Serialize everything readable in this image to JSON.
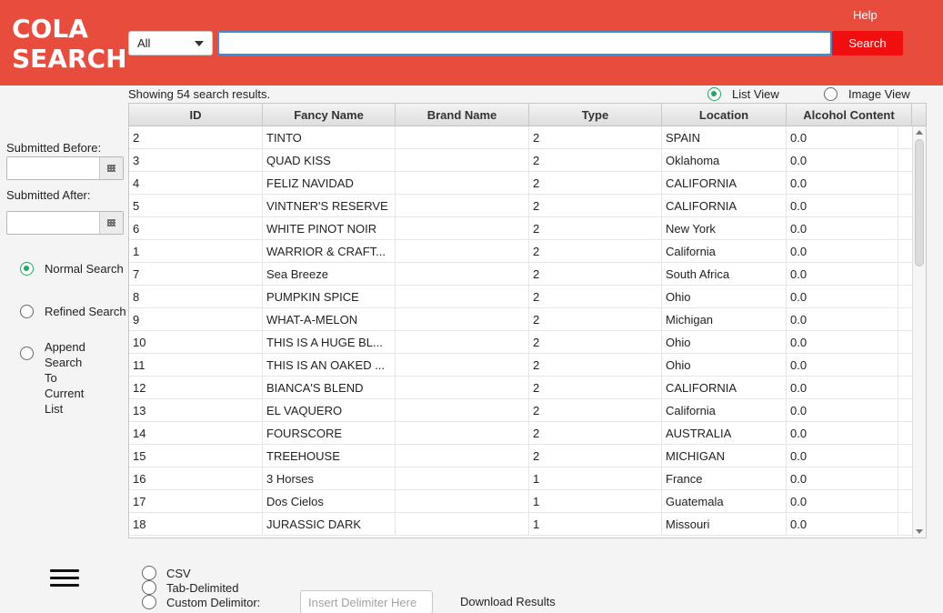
{
  "header": {
    "logo_line1": "COLA",
    "logo_line2": "SEARCH",
    "help": "Help",
    "category_selected": "All",
    "search_value": "",
    "search_button": "Search",
    "accent_color": "#e84c3d"
  },
  "results": {
    "count_text": "Showing 54 search results.",
    "list_view": "List View",
    "image_view": "Image View",
    "selected_view": "List View"
  },
  "filters": {
    "submitted_before": "Submitted Before:",
    "submitted_after": "Submitted After:",
    "before_value": "",
    "after_value": "",
    "calendar_icon": "calendar-icon"
  },
  "modes": {
    "normal": "Normal Search",
    "refined": "Refined Search",
    "append": "Append\nSearch\nTo\nCurrent\nList",
    "selected": "Normal Search"
  },
  "table": {
    "columns": [
      "ID",
      "Fancy Name",
      "Brand Name",
      "Type",
      "Location",
      "Alcohol Content"
    ],
    "rows": [
      [
        "2",
        "TINTO",
        "",
        "2",
        "SPAIN",
        "0.0"
      ],
      [
        "3",
        "QUAD KISS",
        "",
        "2",
        "Oklahoma",
        "0.0"
      ],
      [
        "4",
        "FELIZ NAVIDAD",
        "",
        "2",
        "CALIFORNIA",
        "0.0"
      ],
      [
        "5",
        "VINTNER'S RESERVE",
        "",
        "2",
        "CALIFORNIA",
        "0.0"
      ],
      [
        "6",
        "WHITE PINOT NOIR",
        "",
        "2",
        "New York",
        "0.0"
      ],
      [
        "1",
        "WARRIOR & CRAFT...",
        "",
        "2",
        "California",
        "0.0"
      ],
      [
        "7",
        "Sea Breeze",
        "",
        "2",
        "South Africa",
        "0.0"
      ],
      [
        "8",
        "PUMPKIN SPICE",
        "",
        "2",
        "Ohio",
        "0.0"
      ],
      [
        "9",
        "WHAT-A-MELON",
        "",
        "2",
        "Michigan",
        "0.0"
      ],
      [
        "10",
        "THIS IS A HUGE BL...",
        "",
        "2",
        "Ohio",
        "0.0"
      ],
      [
        "11",
        "THIS IS AN OAKED ...",
        "",
        "2",
        "Ohio",
        "0.0"
      ],
      [
        "12",
        "BIANCA'S BLEND",
        "",
        "2",
        "CALIFORNIA",
        "0.0"
      ],
      [
        "13",
        "EL VAQUERO",
        "",
        "2",
        "California",
        "0.0"
      ],
      [
        "14",
        "FOURSCORE",
        "",
        "2",
        "AUSTRALIA",
        "0.0"
      ],
      [
        "15",
        "TREEHOUSE",
        "",
        "2",
        "MICHIGAN",
        "0.0"
      ],
      [
        "16",
        "3 Horses",
        "",
        "1",
        "France",
        "0.0"
      ],
      [
        "17",
        "Dos Cielos",
        "",
        "1",
        "Guatemala",
        "0.0"
      ],
      [
        "18",
        "JURASSIC DARK",
        "",
        "1",
        "Missouri",
        "0.0"
      ]
    ]
  },
  "export": {
    "csv": "CSV",
    "tab": "Tab-Delimited",
    "custom": "Custom Delimitor:",
    "delimiter_placeholder": "Insert Delimiter Here",
    "download": "Download Results",
    "menu_icon": "hamburger-menu-icon"
  }
}
